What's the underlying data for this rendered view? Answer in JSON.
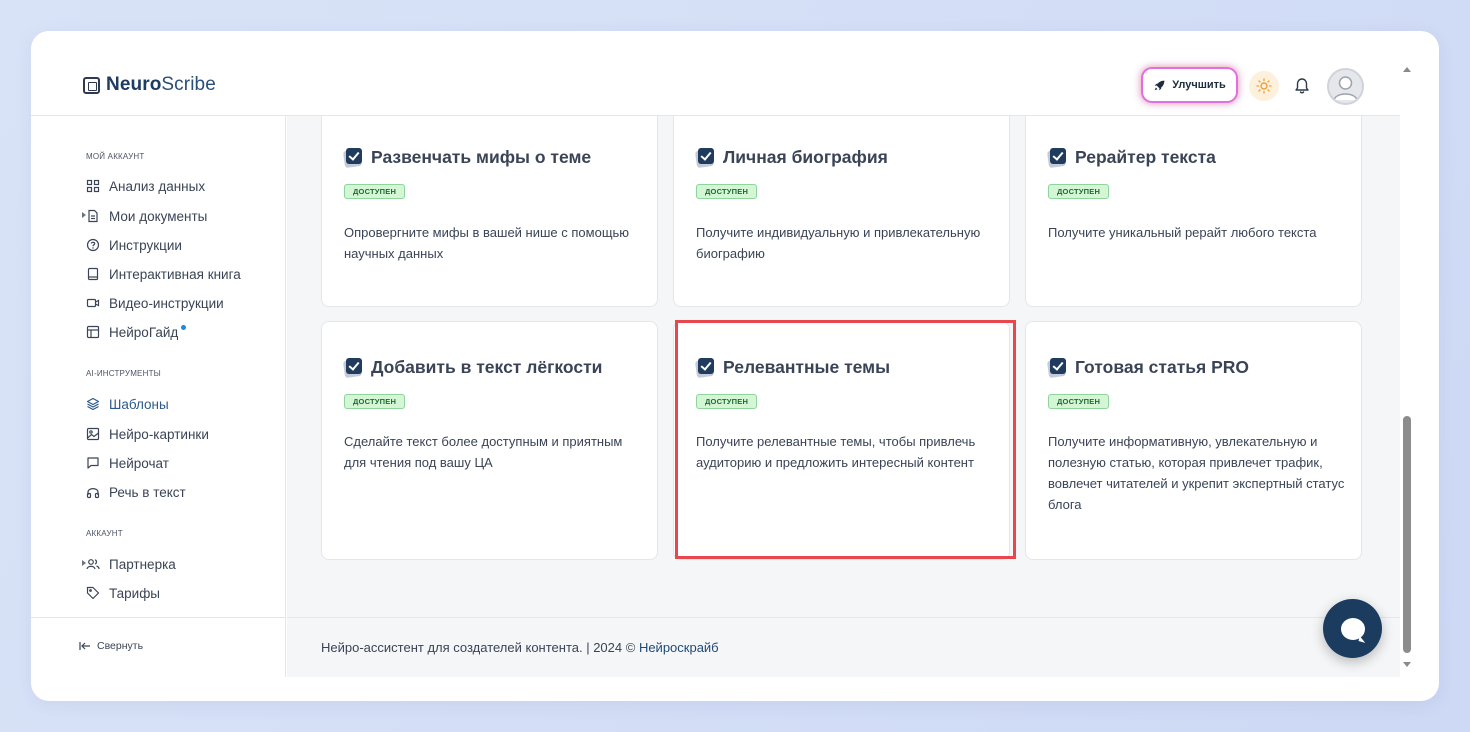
{
  "app": {
    "logo_bold": "Neuro",
    "logo_light": "Scribe"
  },
  "header": {
    "upgrade_label": "Улучшить"
  },
  "sidebar": {
    "section_account": "МОЙ АККАУНТ",
    "section_tools": "AI-ИНСТРУМЕНТЫ",
    "section_acc2": "АККАУНТ",
    "items": [
      {
        "label": "Анализ данных",
        "icon": "grid-icon"
      },
      {
        "label": "Мои документы",
        "icon": "document-icon"
      },
      {
        "label": "Инструкции",
        "icon": "help-circle-icon"
      },
      {
        "label": "Интерактивная книга",
        "icon": "book-icon"
      },
      {
        "label": "Видео-инструкции",
        "icon": "video-icon"
      },
      {
        "label": "НейроГайд",
        "icon": "layout-icon"
      },
      {
        "label": "Шаблоны",
        "icon": "layers-icon"
      },
      {
        "label": "Нейро-картинки",
        "icon": "image-icon"
      },
      {
        "label": "Нейрочат",
        "icon": "chat-icon"
      },
      {
        "label": "Речь в текст",
        "icon": "headphones-icon"
      },
      {
        "label": "Партнерка",
        "icon": "users-icon"
      },
      {
        "label": "Тарифы",
        "icon": "tag-icon"
      }
    ],
    "collapse_label": "Свернуть"
  },
  "cards": [
    {
      "title": "Развенчать мифы о теме",
      "badge": "ДОСТУПЕН",
      "desc": "Опровергните мифы в вашей нише с помощью научных данных"
    },
    {
      "title": "Личная биография",
      "badge": "ДОСТУПЕН",
      "desc": "Получите индивидуальную и привлекательную биографию"
    },
    {
      "title": "Рерайтер текста",
      "badge": "ДОСТУПЕН",
      "desc": "Получите уникальный рерайт любого текста"
    },
    {
      "title": "Добавить в текст лёгкости",
      "badge": "ДОСТУПЕН",
      "desc": "Сделайте текст более доступным и приятным для чтения под вашу ЦА"
    },
    {
      "title": "Релевантные темы",
      "badge": "ДОСТУПЕН",
      "desc": "Получите релевантные темы, чтобы привлечь аудиторию и предложить интересный контент"
    },
    {
      "title": "Готовая статья PRO",
      "badge": "ДОСТУПЕН",
      "desc": "Получите информативную, увлекательную и полезную статью, которая привлечет трафик, вовлечет читателей и укрепит экспертный статус блога"
    }
  ],
  "footer": {
    "text": "Нейро-ассистент для создателей контента.  | 2024 © ",
    "link": "Нейроскрайб"
  },
  "colors": {
    "brand": "#1b3c5f",
    "badge_bg": "#d4f5d6",
    "highlight": "#e6484e"
  }
}
